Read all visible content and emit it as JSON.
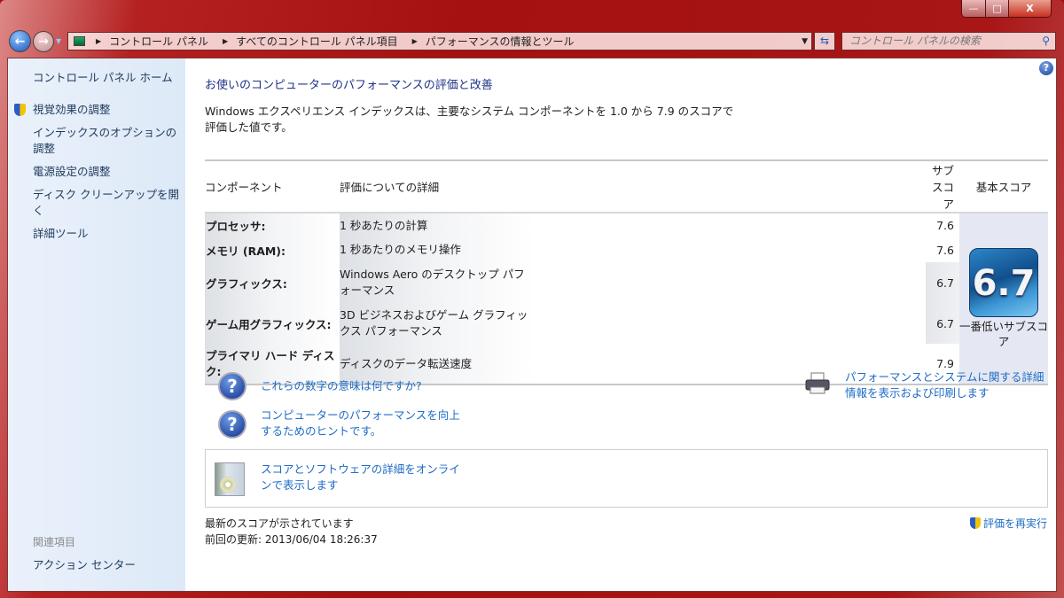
{
  "window": {
    "minimize": "—",
    "maximize": "□",
    "close": "X"
  },
  "address": {
    "crumbs": [
      "コントロール パネル",
      "すべてのコントロール パネル項目",
      "パフォーマンスの情報とツール"
    ]
  },
  "search": {
    "placeholder": "コントロール パネルの検索"
  },
  "sidebar": {
    "home": "コントロール パネル ホーム",
    "items": [
      "視覚効果の調整",
      "インデックスのオプションの調整",
      "電源設定の調整",
      "ディスク クリーンアップを開く",
      "詳細ツール"
    ],
    "related_heading": "関連項目",
    "related": [
      "アクション センター"
    ]
  },
  "main": {
    "title": "お使いのコンピューターのパフォーマンスの評価と改善",
    "description": "Windows エクスペリエンス インデックスは、主要なシステム コンポーネントを 1.0 から 7.9 のスコアで評価した値です。",
    "table": {
      "headers": [
        "コンポーネント",
        "評価についての詳細",
        "サブスコア",
        "基本スコア"
      ],
      "rows": [
        {
          "component": "プロセッサ:",
          "detail": "1 秒あたりの計算",
          "subscore": "7.6"
        },
        {
          "component": "メモリ (RAM):",
          "detail": "1 秒あたりのメモリ操作",
          "subscore": "7.6"
        },
        {
          "component": "グラフィックス:",
          "detail": "Windows Aero のデスクトップ パフォーマンス",
          "subscore": "6.7"
        },
        {
          "component": "ゲーム用グラフィックス:",
          "detail": "3D ビジネスおよびゲーム グラフィックス パフォーマンス",
          "subscore": "6.7"
        },
        {
          "component": "プライマリ ハード ディスク:",
          "detail": "ディスクのデータ転送速度",
          "subscore": "7.9"
        }
      ],
      "base_score": "6.7",
      "base_label": "一番低いサブスコア"
    },
    "links": {
      "meaning": "これらの数字の意味は何ですか?",
      "tips": "コンピューターのパフォーマンスを向上するためのヒントです。",
      "print": "パフォーマンスとシステムに関する詳細情報を表示および印刷します",
      "online": "スコアとソフトウェアの詳細をオンラインで表示します"
    },
    "status": {
      "line1": "最新のスコアが示されています",
      "line2": "前回の更新: 2013/06/04 18:26:37"
    },
    "rerun": "評価を再実行"
  }
}
